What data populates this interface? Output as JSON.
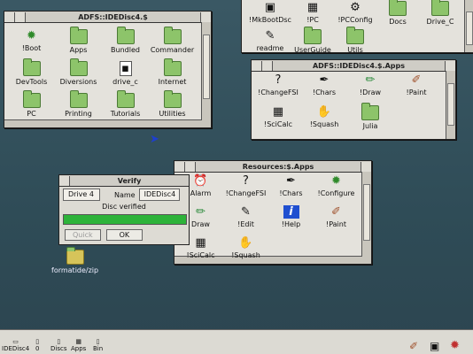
{
  "top_window": {
    "items": [
      "!MkBootDsc",
      "!PC",
      "!PCConfig",
      "Docs",
      "Drive_C",
      "readme",
      "UserGuide",
      "Utils"
    ]
  },
  "adfs_root": {
    "title": "ADFS::IDEDisc4.$",
    "items": [
      "!Boot",
      "Apps",
      "Bundled",
      "Commander",
      "DevTools",
      "Diversions",
      "drive_c",
      "Internet",
      "PC",
      "Printing",
      "Tutorials",
      "Utilities"
    ]
  },
  "apps_window": {
    "title": "ADFS::IDEDisc4.$.Apps",
    "items": [
      "!ChangeFSI",
      "!Chars",
      "!Draw",
      "!Paint",
      "!SciCalc",
      "!Squash",
      "Julia"
    ]
  },
  "resources_window": {
    "title": "Resources:$.Apps",
    "items": [
      "Alarm",
      "!ChangeFSI",
      "!Chars",
      "!Configure",
      "Draw",
      "!Edit",
      "!Help",
      "!Paint",
      "!SciCalc",
      "!Squash"
    ]
  },
  "verify": {
    "title": "Verify",
    "drive_label": "Drive 4",
    "name_label": "Name",
    "name_value": "IDEDisc4",
    "status": "Disc verified",
    "progress": 1.0,
    "quick_label": "Quick",
    "ok_label": "OK"
  },
  "desktop": {
    "file_label": "formatide/zip"
  },
  "iconbar": {
    "items": [
      "IDEDisc4",
      "0",
      "Discs",
      "Apps",
      "Bin"
    ]
  },
  "colors": {
    "progress": "#2db33a",
    "folder": "#8dc46a"
  }
}
